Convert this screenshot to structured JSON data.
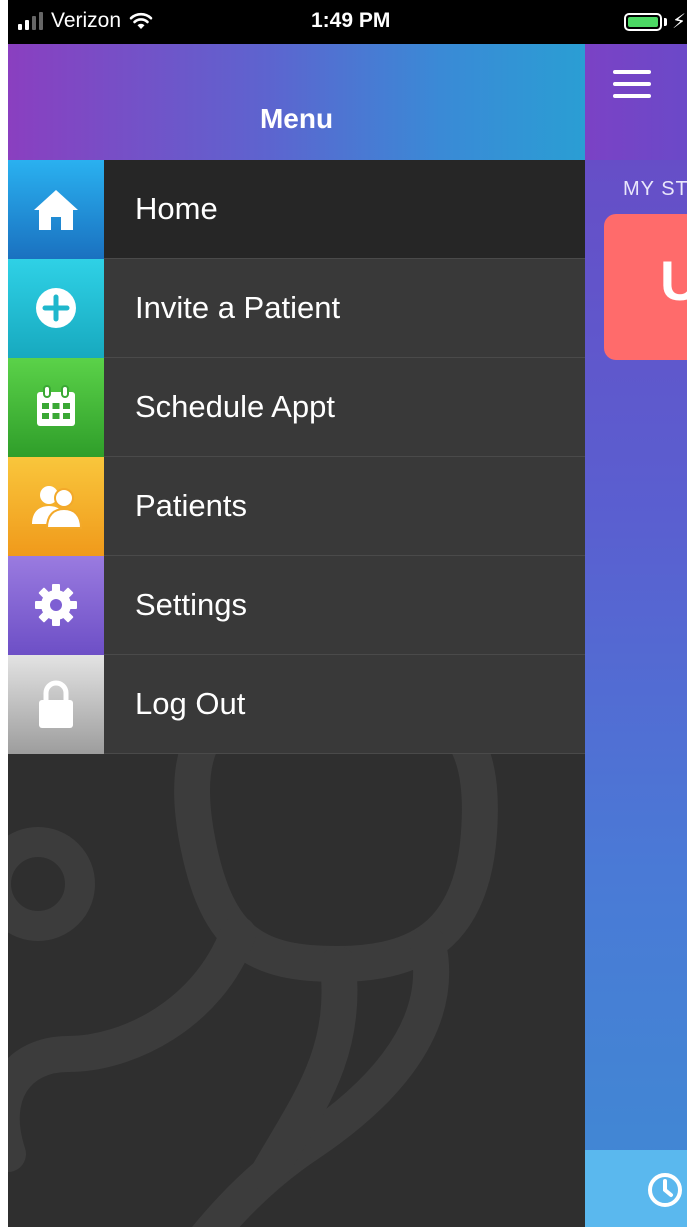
{
  "status_bar": {
    "carrier": "Verizon",
    "time": "1:49 PM",
    "charging_symbol": "⚡",
    "icons": [
      "signal-icon",
      "wifi-icon",
      "battery-icon"
    ]
  },
  "drawer": {
    "title": "Menu",
    "items": [
      {
        "label": "Home",
        "icon": "home-icon",
        "active": true,
        "color": "#2a8fdf"
      },
      {
        "label": "Invite a Patient",
        "icon": "plus-circle-icon",
        "active": false,
        "color": "#22bfd4"
      },
      {
        "label": "Schedule Appt",
        "icon": "calendar-icon",
        "active": false,
        "color": "#45b83a"
      },
      {
        "label": "Patients",
        "icon": "people-icon",
        "active": false,
        "color": "#f4b12a"
      },
      {
        "label": "Settings",
        "icon": "gear-icon",
        "active": false,
        "color": "#8462d6"
      },
      {
        "label": "Log Out",
        "icon": "lock-icon",
        "active": false,
        "color": "#bdbdbd"
      }
    ],
    "watermark_icon": "stethoscope-icon"
  },
  "main_screen": {
    "section_title": "MY ST",
    "card_letter": "U",
    "card_color": "#ff6b6b",
    "menu_icon": "hamburger-icon",
    "bottom_icon": "clock-icon"
  }
}
